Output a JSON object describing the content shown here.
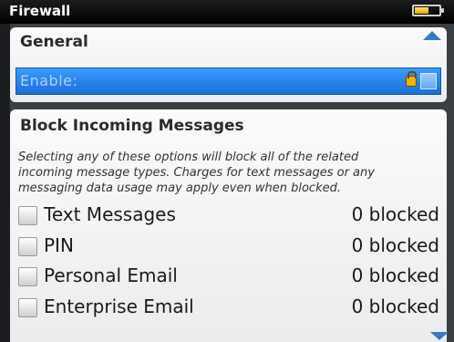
{
  "titlebar": {
    "title": "Firewall",
    "battery_level": 0.55
  },
  "general": {
    "title": "General",
    "enable_label": "Enable:"
  },
  "block": {
    "title": "Block Incoming Messages",
    "description_lines": [
      "Selecting any of these options will block all of the related",
      "incoming message types. Charges for text messages or any",
      "messaging data usage may apply even when blocked."
    ],
    "options": [
      {
        "label": "Text Messages",
        "count": "0 blocked",
        "checked": false
      },
      {
        "label": "PIN",
        "count": "0 blocked",
        "checked": false
      },
      {
        "label": "Personal Email",
        "count": "0 blocked",
        "checked": false
      },
      {
        "label": "Enterprise Email",
        "count": "0 blocked",
        "checked": false
      }
    ]
  },
  "colors": {
    "accent": "#1a6fd8",
    "titlebar": "#000000",
    "panel": "#f4f4f4"
  }
}
